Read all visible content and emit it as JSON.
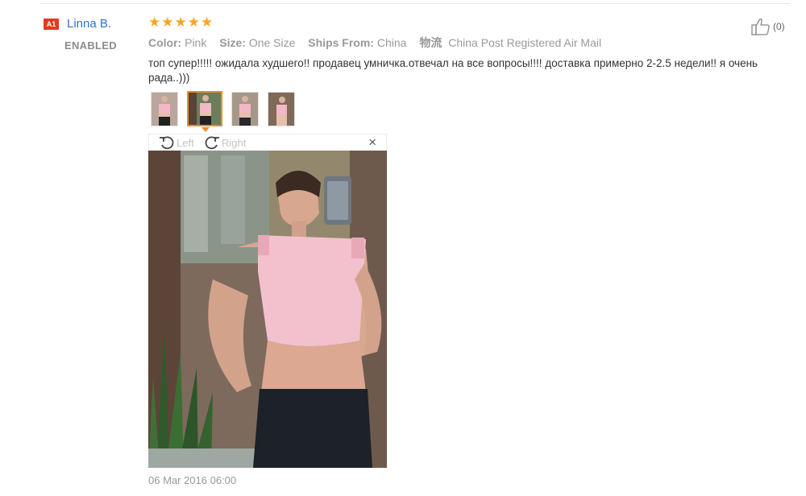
{
  "review": {
    "user": {
      "country": "A1",
      "name": "Linna B.",
      "status": "ENABLED"
    },
    "rating": {
      "stars": 5,
      "max": 5
    },
    "attributes": {
      "color_label": "Color:",
      "color_value": "Pink",
      "size_label": "Size:",
      "size_value": "One Size",
      "ships_label": "Ships From:",
      "ships_value": "China",
      "logistics_label": "物流",
      "logistics_value": "China Post Registered Air Mail"
    },
    "comment": "топ супер!!!!! ожидала худшего!! продавец умничка.отвечал на все вопросы!!!! доставка примерно 2-2.5 недели!! я очень рада..)))",
    "helpful": {
      "icon": "thumbs-up-icon",
      "count": "(0)"
    },
    "thumbnails": [
      {
        "icon": "photo-thumbnail",
        "selected": false
      },
      {
        "icon": "photo-thumbnail",
        "selected": true
      },
      {
        "icon": "photo-thumbnail",
        "selected": false
      },
      {
        "icon": "photo-thumbnail",
        "selected": false
      }
    ],
    "viewer": {
      "rotate_left_label": "Left",
      "rotate_right_label": "Right",
      "close_label": "×",
      "icons": {
        "rotate_left": "rotate-left-icon",
        "rotate_right": "rotate-right-icon",
        "close": "close-icon"
      }
    },
    "date": "06 Mar 2016 06:00"
  },
  "colors": {
    "name_link": "#2f73c8",
    "badge": "#e43a1f",
    "star": "#f5a623",
    "thumb_selected_border": "#f08a24",
    "muted_text": "#999999"
  }
}
